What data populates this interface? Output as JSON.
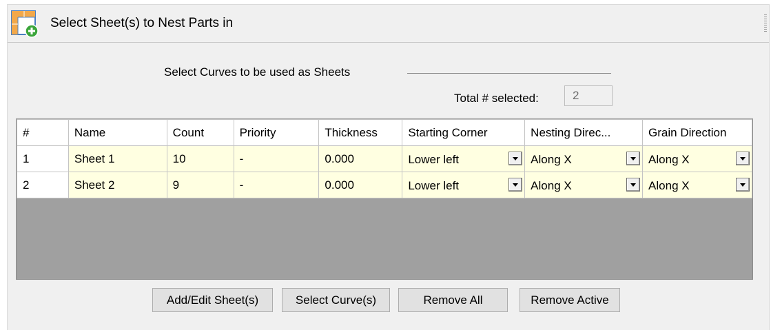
{
  "header": {
    "title": "Select Sheet(s) to Nest Parts in",
    "icon": "sheet-add-icon"
  },
  "selection": {
    "label": "Select Curves to be used as Sheets",
    "total_label": "Total # selected:",
    "total_value": "2"
  },
  "table": {
    "columns": [
      "#",
      "Name",
      "Count",
      "Priority",
      "Thickness",
      "Starting Corner",
      "Nesting Direc...",
      "Grain Direction"
    ],
    "rows": [
      {
        "num": "1",
        "name": "Sheet 1",
        "count": "10",
        "priority": "-",
        "thickness": "0.000",
        "starting_corner": "Lower left",
        "nesting_direction": "Along X",
        "grain_direction": "Along X"
      },
      {
        "num": "2",
        "name": "Sheet 2",
        "count": "9",
        "priority": "-",
        "thickness": "0.000",
        "starting_corner": "Lower left",
        "nesting_direction": "Along X",
        "grain_direction": "Along X"
      }
    ]
  },
  "buttons": {
    "add_edit": "Add/Edit Sheet(s)",
    "select_curves": "Select Curve(s)",
    "remove_all": "Remove All",
    "remove_active": "Remove Active"
  },
  "colors": {
    "cell_bg": "#ffffe1",
    "empty_area": "#a0a0a0",
    "panel_bg": "#f0f0f0"
  }
}
